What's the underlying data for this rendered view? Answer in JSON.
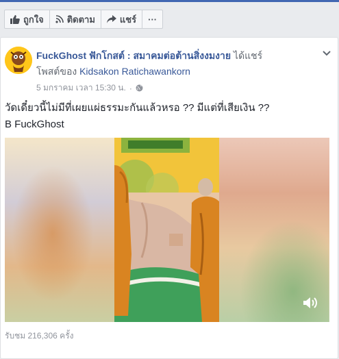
{
  "action_bar": {
    "like_label": "ถูกใจ",
    "follow_label": "ติดตาม",
    "share_label": "แชร์",
    "more_label": "···"
  },
  "post": {
    "page_name": "FuckGhost ฟักโกสต์ : สมาคมต่อต้านสิ่งงมงาย",
    "shared_text": "ได้แชร์",
    "post_of_text": "โพสต์ของ",
    "original_author": "Kidsakon Ratichawankorn",
    "timestamp": "5 มกราคม เวลา 15:30 น.",
    "separator": "·",
    "body_line1": "วัดเดี๋ยวนี้ไม่มีที่เผยแผ่ธรรมะกันแล้วหรอ ?? มีแต่ที่เสียเงิน ??",
    "body_line2": "B FuckGhost",
    "views": "รับชม 216,306 ครั้ง"
  },
  "icons": {
    "like": "thumbs-up-icon",
    "follow": "rss-icon",
    "share": "share-arrow-icon",
    "privacy": "globe-icon",
    "menu": "chevron-down-icon",
    "sound": "speaker-icon"
  },
  "colors": {
    "link": "#385898",
    "brand": "#4267b2",
    "muted": "#90949c"
  }
}
